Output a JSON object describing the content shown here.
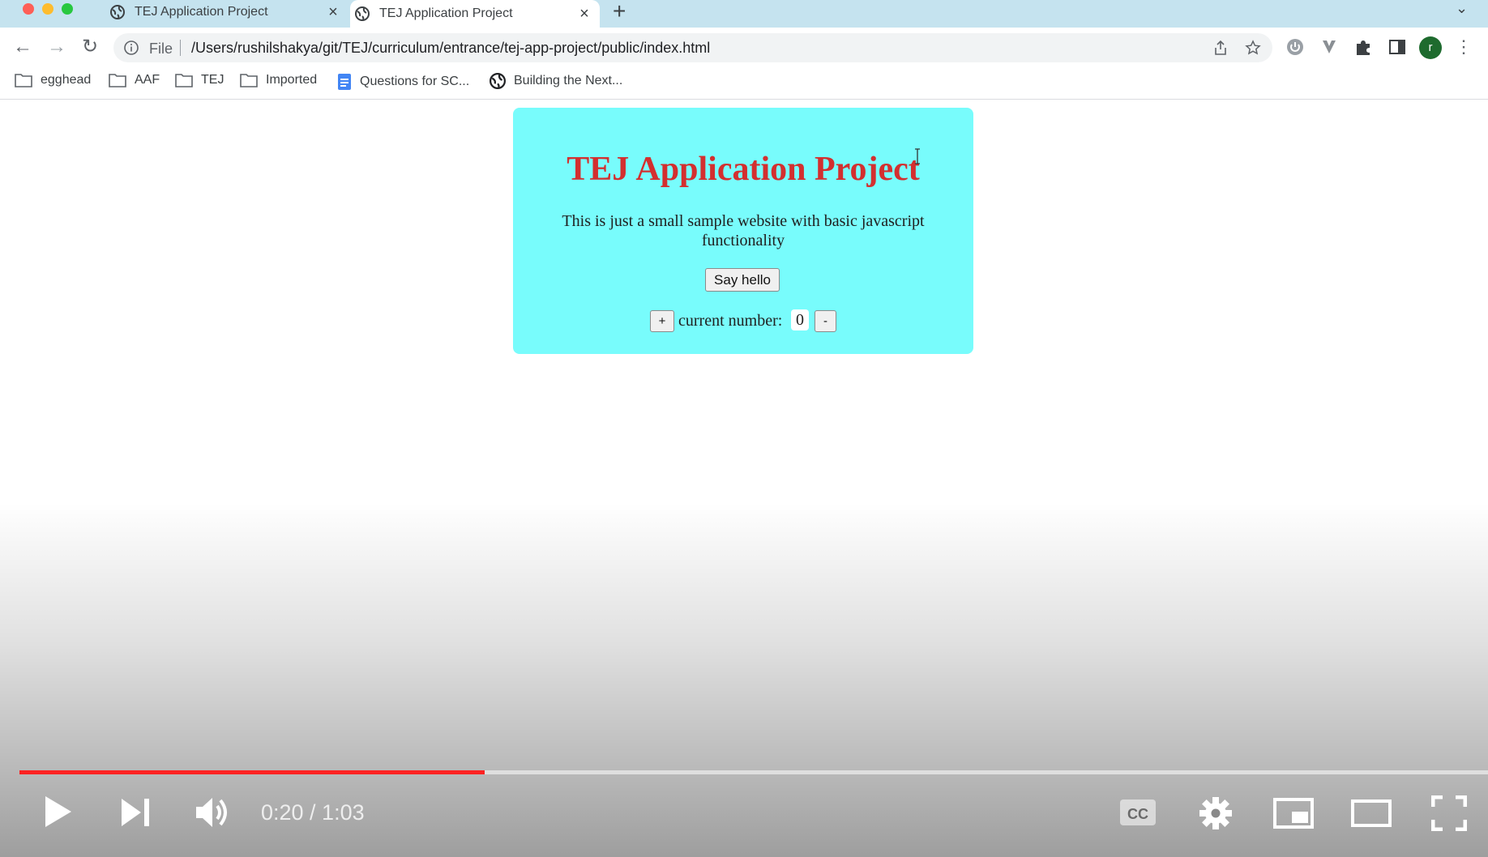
{
  "browser": {
    "tabs": [
      {
        "label": "TEJ Application Project",
        "active": false
      },
      {
        "label": "TEJ Application Project",
        "active": true
      }
    ],
    "new_tab_symbol": "+",
    "address": {
      "scheme_label": "File",
      "url": "/Users/rushilshakya/git/TEJ/curriculum/entrance/tej-app-project/public/index.html"
    },
    "profile_initial": "r",
    "bookmarks": [
      {
        "label": "egghead",
        "icon": "folder-icon"
      },
      {
        "label": "AAF",
        "icon": "folder-icon"
      },
      {
        "label": "TEJ",
        "icon": "folder-icon"
      },
      {
        "label": "Imported",
        "icon": "folder-icon"
      },
      {
        "label": "Questions for SC...",
        "icon": "docs-icon"
      },
      {
        "label": "Building the Next...",
        "icon": "globe-icon"
      }
    ]
  },
  "page": {
    "title": "TEJ Application Project",
    "description": "This is just a small sample website with basic javascript functionality",
    "say_hello_label": "Say hello",
    "plus_label": "+",
    "minus_label": "-",
    "counter_label": "current number:",
    "counter_value": "0"
  },
  "video": {
    "time": "0:20 / 1:03",
    "progress_fraction": 0.317
  },
  "colors": {
    "card_bg": "#78fcfc",
    "title": "#d32f2f",
    "progress": "#ff2222",
    "tabbar": "#c5e3ef"
  }
}
